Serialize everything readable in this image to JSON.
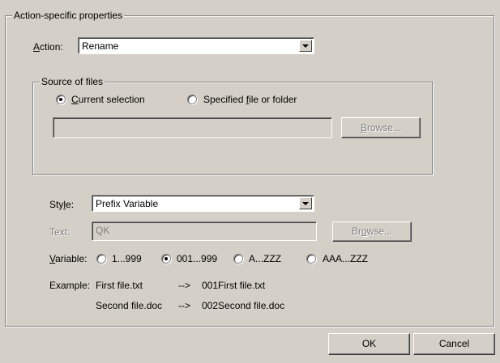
{
  "group_title": "Action-specific properties",
  "action": {
    "label": "Action:",
    "value": "Rename"
  },
  "source": {
    "title": "Source of files",
    "radio_current": "Current selection",
    "radio_specified": "Specified file or folder",
    "path_value": "",
    "browse_label": "Browse..."
  },
  "style": {
    "label": "Style:",
    "value": "Prefix Variable"
  },
  "text": {
    "label": "Text:",
    "value": "QK",
    "browse_label": "Browse..."
  },
  "variable": {
    "label": "Variable:",
    "options": [
      "1...999",
      "001...999",
      "A...ZZZ",
      "AAA...ZZZ"
    ],
    "selected": "001...999"
  },
  "example": {
    "label": "Example:",
    "rows": [
      {
        "source": "First file.txt",
        "arrow": "-->",
        "result": "001First file.txt"
      },
      {
        "source": "Second file.doc",
        "arrow": "-->",
        "result": "002Second file.doc"
      }
    ]
  },
  "buttons": {
    "ok": "OK",
    "cancel": "Cancel"
  }
}
